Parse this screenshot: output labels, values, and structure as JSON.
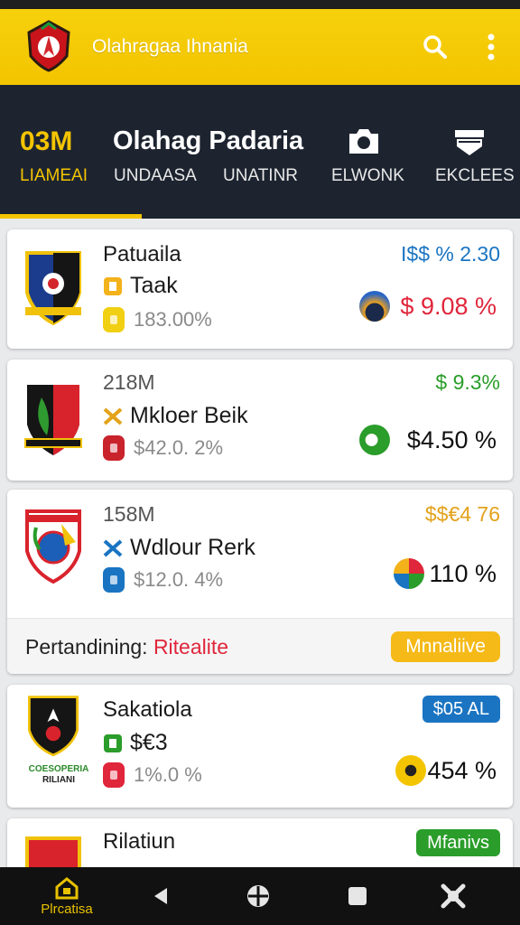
{
  "app": {
    "title": "Olahragaa Ihnania"
  },
  "tabbar": {
    "amount": "03M",
    "title": "Olahag Padaria",
    "tabs": [
      "LIAMEAI",
      "UNDAASA",
      "UNATINR",
      "ELWONK",
      "EKCLEES"
    ]
  },
  "cards": [
    {
      "name": "Patuaila",
      "sub": "Taak",
      "pct": "183.00%",
      "top": "I$$ % 2.30",
      "price": "$ 9.08 %"
    },
    {
      "count": "218M",
      "sub": "Mkloer Beik",
      "pct": "$42.0. 2%",
      "top": "$ 9.3%",
      "price": "$4.50 %"
    },
    {
      "count": "158M",
      "sub": "Wdlour Rerk",
      "pct": "$12.0. 4%",
      "top": "$$€4 76",
      "price": "110 %",
      "strip": {
        "label": "Pertandining:",
        "value": "Ritealite",
        "button": "Mnnaliive"
      }
    },
    {
      "name": "Sakatiola",
      "sub": "$€3",
      "pct": "1%.0 %",
      "badge": "$05 AL",
      "price": "454 %",
      "crest_text": [
        "COESOPERIA",
        "RILIANI"
      ]
    },
    {
      "name": "Rilatiun",
      "badge": "Mfanivs"
    }
  ],
  "nav": {
    "home_label": "Plrcatisa"
  },
  "colors": {
    "brand": "#f3c400",
    "header": "#1d2430",
    "negative": "#e0263b",
    "positive": "#2a9d2a",
    "accent_blue": "#1a74c2"
  }
}
